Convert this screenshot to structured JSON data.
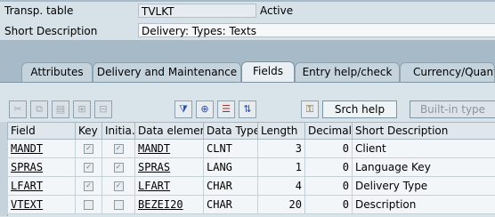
{
  "header": {
    "transp_table_label": "Transp. table",
    "transp_table_value": "TVLKT",
    "status": "Active",
    "short_desc_label": "Short Description",
    "short_desc_value": "Delivery: Types: Texts"
  },
  "tabs": [
    {
      "label": "Attributes"
    },
    {
      "label": "Delivery and Maintenance"
    },
    {
      "label": "Fields"
    },
    {
      "label": "Entry help/check"
    },
    {
      "label": "Currency/Quanti"
    }
  ],
  "toolbar": {
    "srch_help_label": "Srch help",
    "built_in_type_label": "Built-in type",
    "icons": [
      "cut-icon",
      "copy-icon",
      "paste-icon",
      "insert-row-icon",
      "delete-row-icon",
      "filter-icon",
      "new-rows-icon",
      "key-icon",
      "tree-icon",
      "search-key-icon"
    ]
  },
  "grid": {
    "columns": [
      "Field",
      "Key",
      "Initia...",
      "Data element",
      "Data Type",
      "Length",
      "Decimal...",
      "Short Description"
    ],
    "rows": [
      {
        "field": "MANDT",
        "key": true,
        "initial": true,
        "data_element": "MANDT",
        "data_type": "CLNT",
        "length": "3",
        "decimal": "0",
        "short_desc": "Client"
      },
      {
        "field": "SPRAS",
        "key": true,
        "initial": true,
        "data_element": "SPRAS",
        "data_type": "LANG",
        "length": "1",
        "decimal": "0",
        "short_desc": "Language Key"
      },
      {
        "field": "LFART",
        "key": true,
        "initial": true,
        "data_element": "LFART",
        "data_type": "CHAR",
        "length": "4",
        "decimal": "0",
        "short_desc": "Delivery Type"
      },
      {
        "field": "VTEXT",
        "key": false,
        "initial": false,
        "data_element": "BEZEI20",
        "data_type": "CHAR",
        "length": "20",
        "decimal": "0",
        "short_desc": "Description"
      }
    ]
  }
}
